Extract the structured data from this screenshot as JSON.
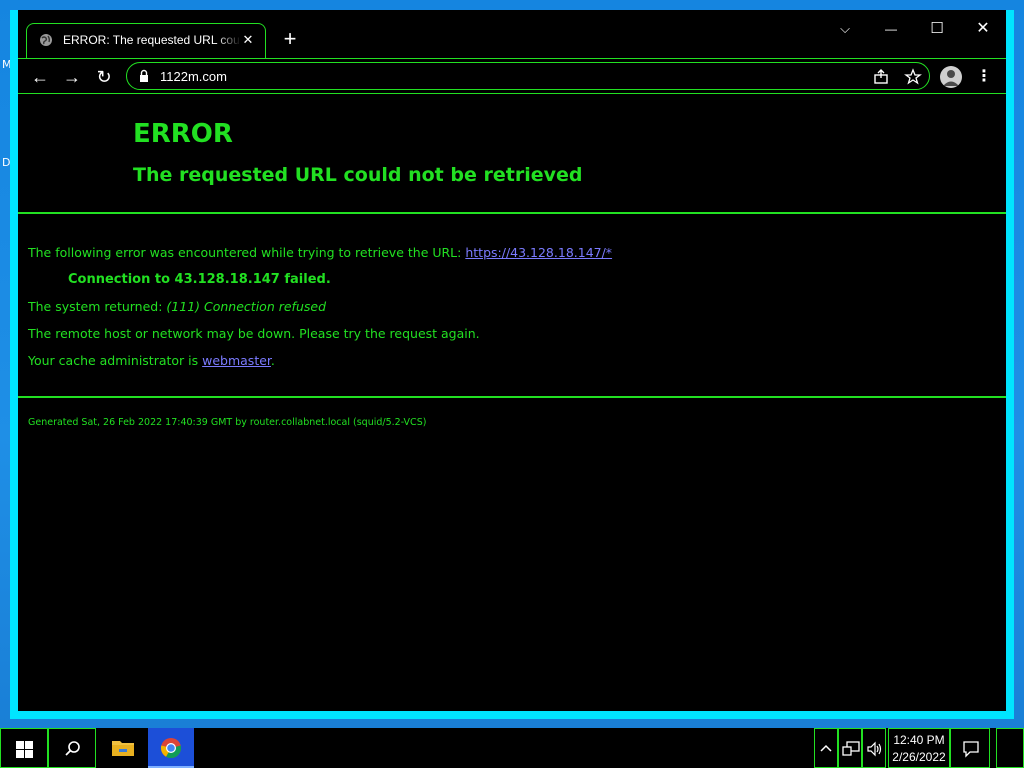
{
  "desktop": {
    "letters": [
      "M",
      "D"
    ]
  },
  "browser": {
    "tab": {
      "title": "ERROR: The requested URL could not be retrieved",
      "close_label": "✕"
    },
    "new_tab_label": "+",
    "window_controls": {
      "tab_search": "⌵",
      "minimize": "—",
      "maximize": "☐",
      "close": "✕"
    },
    "toolbar": {
      "back": "←",
      "forward": "→",
      "reload": "↻",
      "url": "1122m.com",
      "menu": "⋮"
    }
  },
  "page": {
    "title": "ERROR",
    "subtitle": "The requested URL could not be retrieved",
    "intro_text": "The following error was encountered while trying to retrieve the URL: ",
    "error_url": "https://43.128.18.147/*",
    "failure": "Connection to 43.128.18.147 failed.",
    "system_returned_label": "The system returned: ",
    "system_returned_value": "(111) Connection refused",
    "remote_host_text": "The remote host or network may be down. Please try the request again.",
    "cache_admin_text": "Your cache administrator is ",
    "cache_admin_link": "webmaster",
    "cache_admin_suffix": ".",
    "footer": "Generated Sat, 26 Feb 2022 17:40:39 GMT by router.collabnet.local (squid/5.2-VCS)"
  },
  "taskbar": {
    "time": "12:40 PM",
    "date": "2/26/2022"
  },
  "colors": {
    "accent_green": "#22e022",
    "link": "#7b7bff",
    "window_border": "#00e5ff",
    "desktop": "#1a7fd6"
  }
}
